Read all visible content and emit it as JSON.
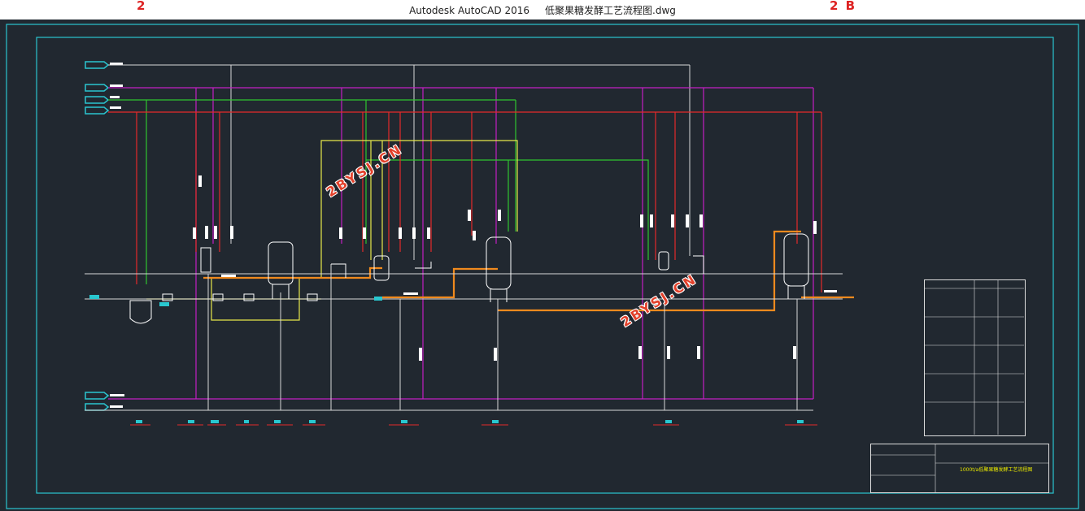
{
  "window": {
    "title": "Autodesk AutoCAD 2016     低聚果糖发酵工艺流程图.dwg"
  },
  "watermarks": {
    "main": "2BYSJ.CN",
    "corner_left": "2",
    "corner_right": "2 B"
  },
  "drawing": {
    "title_block_name": "1000t/a低聚果糖发酵工艺流程图"
  },
  "colors": {
    "background": "#212830",
    "steam": "#e52a2a",
    "water": "#c41fc4",
    "air": "#2fc52f",
    "material": "#e8e84a",
    "product": "#f08a1e",
    "structure": "#d8d8d8",
    "tag": "#29c7cf"
  }
}
